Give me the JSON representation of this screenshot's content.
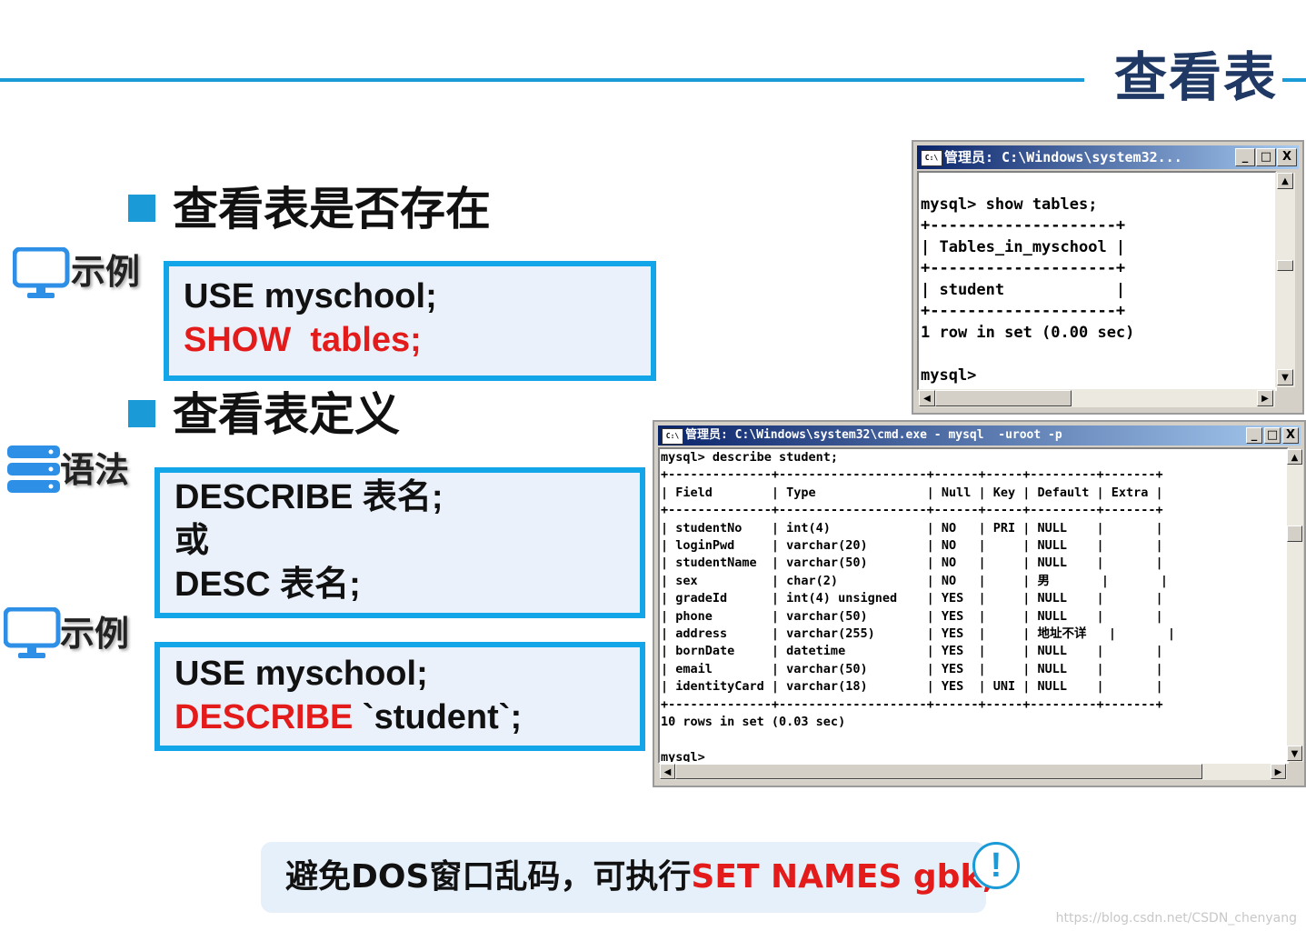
{
  "page_title": "查看表",
  "section1": {
    "heading": "查看表是否存在",
    "example_label": "示例",
    "code_line1": "USE myschool;",
    "code_line2": "SHOW  tables;"
  },
  "section2": {
    "heading": "查看表定义",
    "syntax_label": "语法",
    "syntax_line1": "DESCRIBE 表名;",
    "syntax_line2": "或",
    "syntax_line3": "DESC 表名;",
    "example_label": "示例",
    "code_line1": "USE myschool;",
    "code_line2_red": "DESCRIBE",
    "code_line2_rest": " `student`;"
  },
  "console1": {
    "title": "管理员: C:\\Windows\\system32...",
    "text": "\nmysql> show tables;\n+--------------------+\n| Tables_in_myschool |\n+--------------------+\n| student            |\n+--------------------+\n1 row in set (0.00 sec)\n\nmysql>"
  },
  "console2": {
    "title": "管理员: C:\\Windows\\system32\\cmd.exe - mysql  -uroot -p",
    "text": "mysql> describe student;\n+--------------+--------------------+------+-----+---------+-------+\n| Field        | Type               | Null | Key | Default | Extra |\n+--------------+--------------------+------+-----+---------+-------+\n| studentNo    | int(4)             | NO   | PRI | NULL    |       |\n| loginPwd     | varchar(20)        | NO   |     | NULL    |       |\n| studentName  | varchar(50)        | NO   |     | NULL    |       |\n| sex          | char(2)            | NO   |     | 男       |       |\n| gradeId      | int(4) unsigned    | YES  |     | NULL    |       |\n| phone        | varchar(50)        | YES  |     | NULL    |       |\n| address      | varchar(255)       | YES  |     | 地址不详   |       |\n| bornDate     | datetime           | YES  |     | NULL    |       |\n| email        | varchar(50)        | YES  |     | NULL    |       |\n| identityCard | varchar(18)        | YES  | UNI | NULL    |       |\n+--------------+--------------------+------+-----+---------+-------+\n10 rows in set (0.03 sec)\n\nmysql>"
  },
  "note": {
    "text_black": "避免DOS窗口乱码，可执行",
    "text_red": "SET NAMES gbk;",
    "icon_text": "!"
  },
  "watermark": "https://blog.csdn.net/CSDN_chenyang",
  "window_buttons": {
    "minimize": "_",
    "maximize": "□",
    "close": "X"
  },
  "scroll_glyphs": {
    "up": "▲",
    "down": "▼",
    "left": "◀",
    "right": "▶"
  },
  "console_icon_text": "C:\\"
}
